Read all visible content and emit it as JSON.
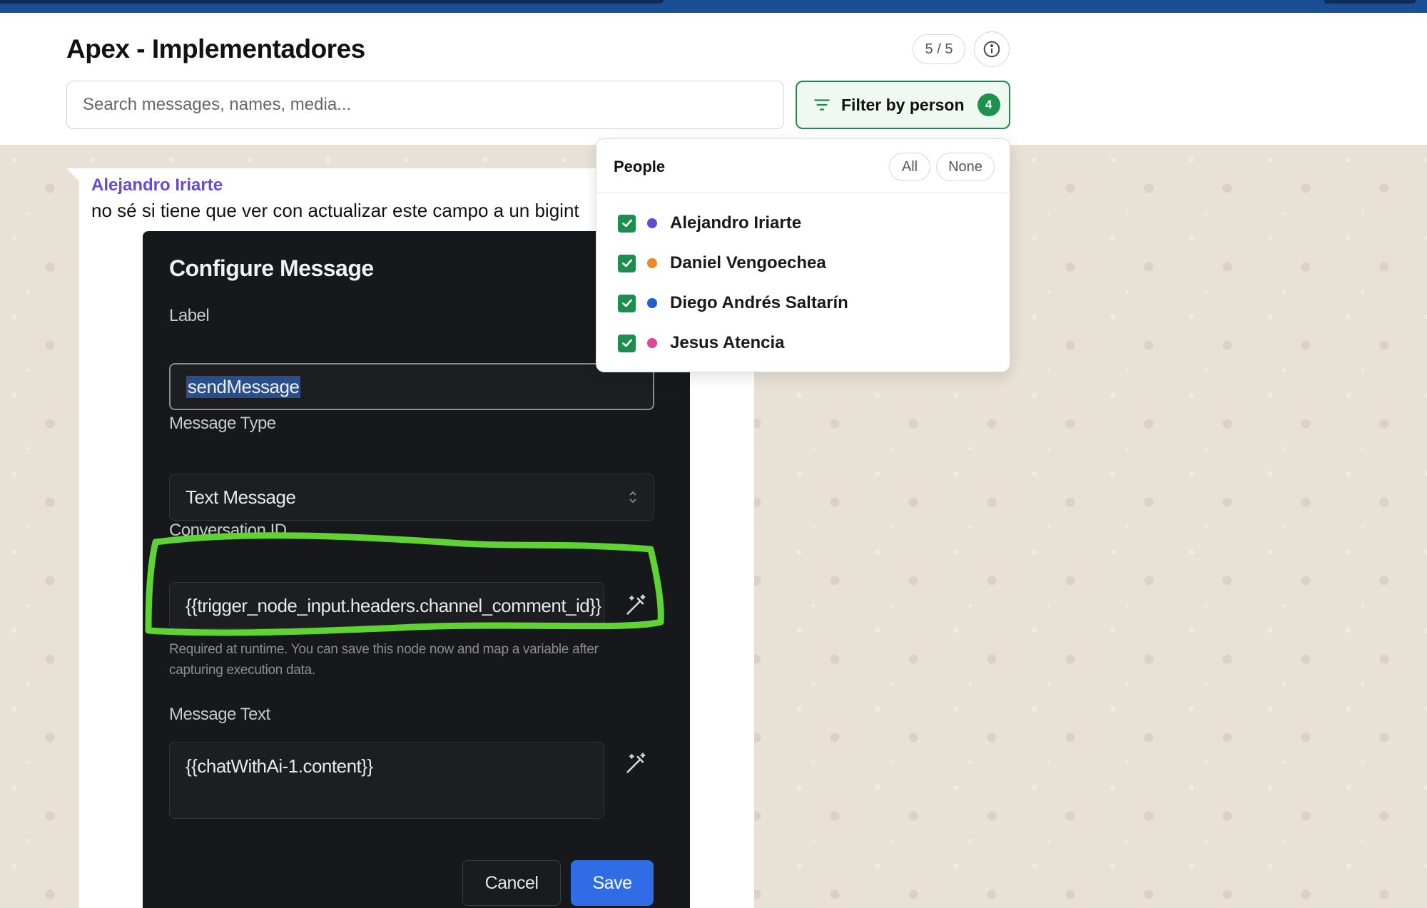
{
  "header": {
    "title": "Apex - Implementadores",
    "count": "5 / 5",
    "search_placeholder": "Search messages, names, media...",
    "filter_label": "Filter by person",
    "filter_badge": "4"
  },
  "message": {
    "sender": "Alejandro Iriarte",
    "text": "no sé si tiene que ver con actualizar este campo a un bigint",
    "sender_color": "#6a48d6"
  },
  "screenshot": {
    "title": "Configure Message",
    "label_field_label": "Label",
    "label_field_value": "sendMessage",
    "type_field_label": "Message Type",
    "type_field_value": "Text Message",
    "conversation_field_label": "Conversation ID",
    "conversation_field_value": "{{trigger_node_input.headers.channel_comment_id}}",
    "conversation_hint": "Required at runtime. You can save this node now and map a variable after capturing execution data.",
    "message_text_label": "Message Text",
    "message_text_value": "{{chatWithAi-1.content}}",
    "cancel_label": "Cancel",
    "save_label": "Save",
    "highlight_color": "#5fd334"
  },
  "people_filter": {
    "title": "People",
    "all_label": "All",
    "none_label": "None",
    "people": [
      {
        "name": "Alejandro Iriarte",
        "color": "#6a48d6",
        "checked": true
      },
      {
        "name": "Daniel Vengoechea",
        "color": "#e88a2a",
        "checked": true
      },
      {
        "name": "Diego Andrés Saltarín",
        "color": "#1f5fd1",
        "checked": true
      },
      {
        "name": "Jesus Atencia",
        "color": "#e0459a",
        "checked": true
      }
    ]
  },
  "colors": {
    "topbar": "#1b4f95",
    "accent_green": "#1e9150"
  }
}
